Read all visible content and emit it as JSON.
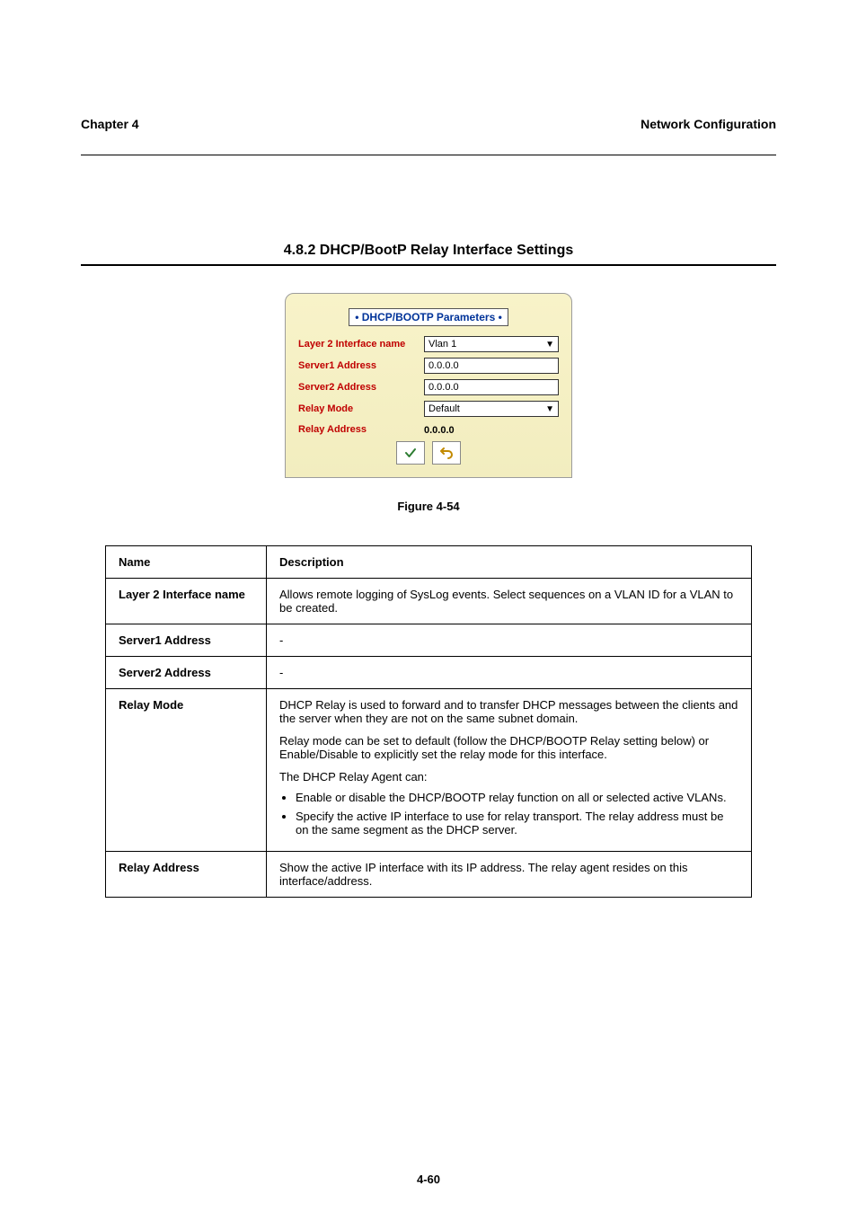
{
  "header": {
    "chapter_no": "Chapter 4",
    "chapter_title": "Network Configuration"
  },
  "section": {
    "title": "4.8.2 DHCP/BootP Relay Interface Settings"
  },
  "figure": {
    "panel_title": "• DHCP/BOOTP Parameters •",
    "rows": {
      "layer2_label": "Layer 2 Interface name",
      "layer2_value": "Vlan 1",
      "server1_label": "Server1 Address",
      "server1_value": "0.0.0.0",
      "server2_label": "Server2 Address",
      "server2_value": "0.0.0.0",
      "relaymode_label": "Relay Mode",
      "relaymode_value": "Default",
      "relayaddr_label": "Relay Address",
      "relayaddr_value": "0.0.0.0"
    },
    "caption": "Figure 4-54"
  },
  "table": {
    "head_name": "Name",
    "head_desc": "Description",
    "rows": [
      {
        "name": "Layer 2 Interface name",
        "desc": "Allows remote logging of SysLog events. Select sequences on a VLAN ID for a VLAN to be created."
      },
      {
        "name": "Server1 Address",
        "desc": "-"
      },
      {
        "name": "Server2 Address",
        "desc": "-"
      },
      {
        "name": "Relay Mode",
        "desc_lines": [
          "DHCP Relay is used to forward and to transfer DHCP messages between the clients and the server when they are not on the same subnet domain.",
          "Relay mode can be set to default (follow the DHCP/BOOTP Relay setting below) or Enable/Disable to explicitly set the relay mode for this interface.",
          "The DHCP Relay Agent can:"
        ],
        "bullets": [
          "Enable or disable the DHCP/BOOTP relay function on all or selected active VLANs.",
          "Specify the active IP interface to use for relay transport. The relay address must be on the same segment as the DHCP server."
        ]
      },
      {
        "name": "Relay Address",
        "desc": "Show the active IP interface with its IP address. The relay agent resides on this interface/address."
      }
    ]
  },
  "page_no": "4-60"
}
